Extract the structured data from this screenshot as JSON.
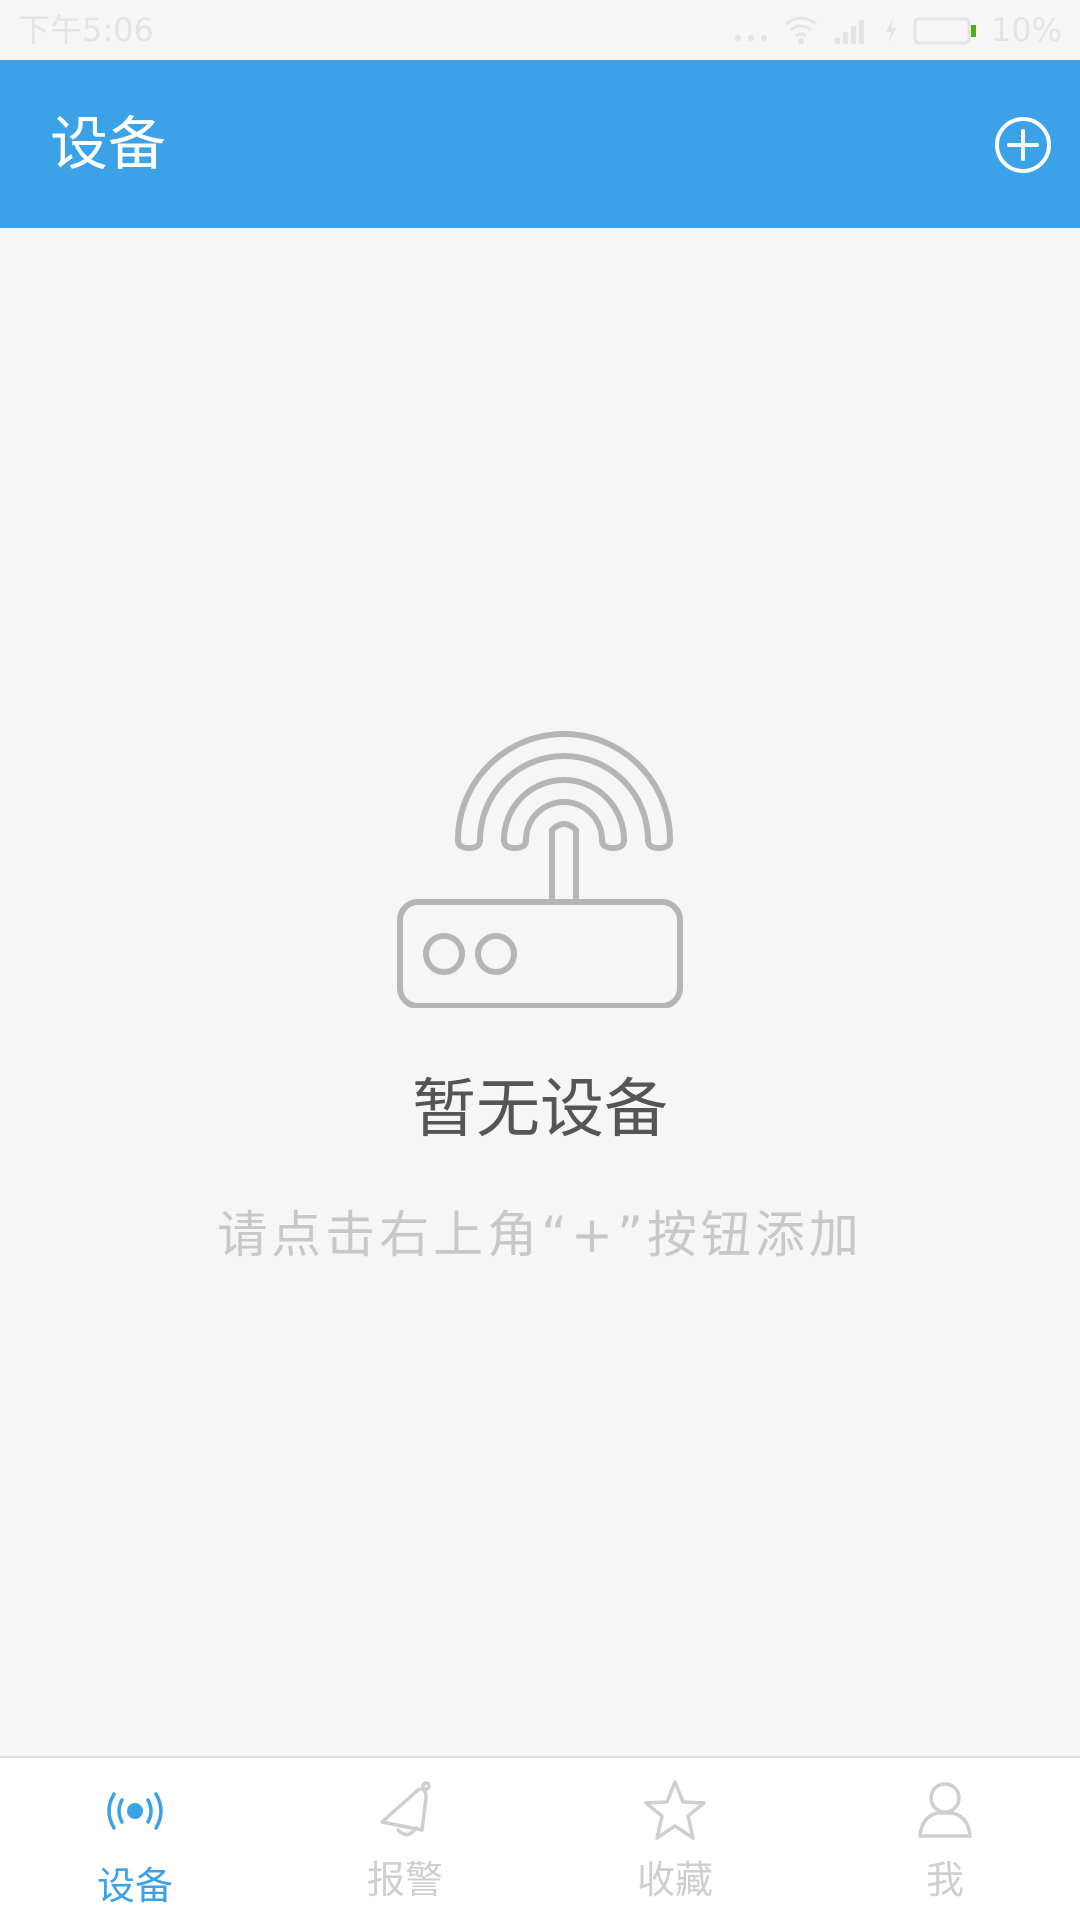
{
  "status_bar": {
    "time": "下午5:06",
    "battery_percent": "10%",
    "icons": [
      "more-dots-icon",
      "wifi-icon",
      "signal-icon",
      "charging-icon",
      "battery-icon"
    ]
  },
  "app_bar": {
    "title": "设备",
    "add_icon": "add-circle-icon"
  },
  "empty_state": {
    "icon": "router-icon",
    "title": "暂无设备",
    "hint": "请点击右上角“+”按钮添加"
  },
  "bottom_nav": {
    "items": [
      {
        "label": "设备",
        "icon": "broadcast-icon",
        "active": true
      },
      {
        "label": "报警",
        "icon": "bell-icon",
        "active": false
      },
      {
        "label": "收藏",
        "icon": "star-icon",
        "active": false
      },
      {
        "label": "我",
        "icon": "person-icon",
        "active": false
      }
    ]
  },
  "colors": {
    "accent": "#3ba2e8",
    "background": "#f6f6f6",
    "inactive": "#cfcfcf",
    "battery_green": "#4caf1a"
  }
}
